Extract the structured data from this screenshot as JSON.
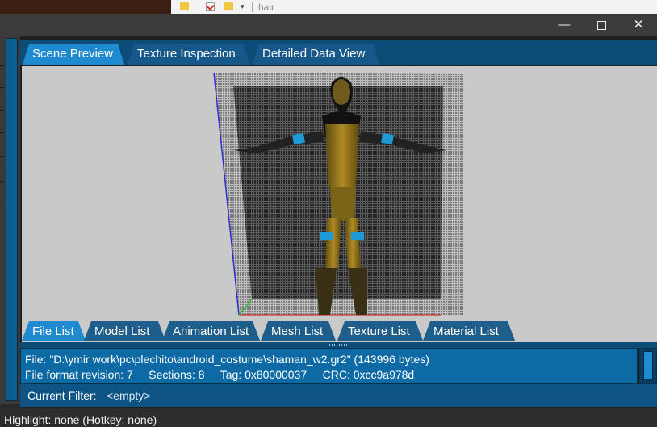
{
  "os_strip": {
    "folder_title": "hair"
  },
  "window": {
    "minimize": "—",
    "close": "✕"
  },
  "top_tabs": [
    {
      "label": "Scene Preview",
      "active": true
    },
    {
      "label": "Texture Inspection",
      "active": false
    },
    {
      "label": "Detailed Data View",
      "active": false
    }
  ],
  "bottom_tabs": [
    {
      "label": "File List",
      "active": true
    },
    {
      "label": "Model List",
      "active": false
    },
    {
      "label": "Animation List",
      "active": false
    },
    {
      "label": "Mesh List",
      "active": false
    },
    {
      "label": "Texture List",
      "active": false
    },
    {
      "label": "Material List",
      "active": false
    }
  ],
  "file_info": {
    "line1": "File: \"D:\\ymir work\\pc\\plechito\\android_costume\\shaman_w2.gr2\" (143996 bytes)",
    "line2": "File format revision: 7     Sections: 8     Tag: 0x80000037     CRC: 0xcc9a978d"
  },
  "filter": {
    "label": "Current Filter:",
    "value": "<empty>"
  },
  "status": {
    "text": "Highlight: none (Hotkey: none)"
  },
  "colors": {
    "accent": "#1f8ad0",
    "tab_bar": "#0e4c78",
    "info_panel": "#0e6aa5",
    "viewport_bg": "#c9c9c9"
  }
}
